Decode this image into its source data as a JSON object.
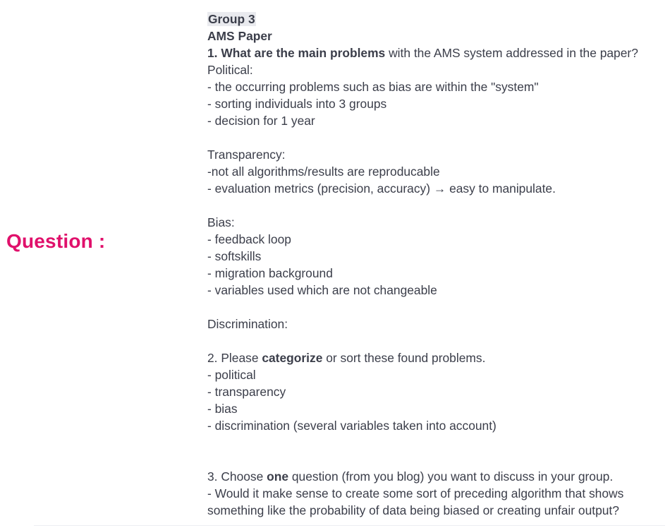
{
  "question_label": "Question :",
  "doc": {
    "group": "Group 3",
    "paper": "AMS Paper",
    "q1": {
      "bold": "1. What are the main problems",
      "rest": " with the AMS system addressed in the paper?"
    },
    "political": {
      "heading": "Political:",
      "items": [
        "- the occurring problems such as bias are within the \"system\"",
        "- sorting individuals into 3 groups",
        "- decision for 1 year"
      ]
    },
    "transparency": {
      "heading": "Transparency:",
      "items": [
        "-not all algorithms/results are reproducable",
        "- evaluation metrics (precision, accuracy) → easy to manipulate."
      ]
    },
    "bias": {
      "heading": "Bias:",
      "items": [
        "- feedback loop",
        "- softskills",
        "- migration background",
        "- variables used which are not changeable"
      ]
    },
    "discrimination": {
      "heading": "Discrimination:"
    },
    "q2": {
      "pre": "2. Please ",
      "bold": "categorize",
      "post": " or sort these found problems.",
      "items": [
        "- political",
        "- transparency",
        "- bias",
        "- discrimination (several variables taken into account)"
      ]
    },
    "q3": {
      "pre": "3. Choose ",
      "bold": "one",
      "post": " question (from you blog) you want to discuss in your group.",
      "answer_lines": [
        "- Would it make sense to create some sort of preceding algorithm that shows",
        "something like the probability of data being biased or creating unfair output?"
      ]
    }
  }
}
